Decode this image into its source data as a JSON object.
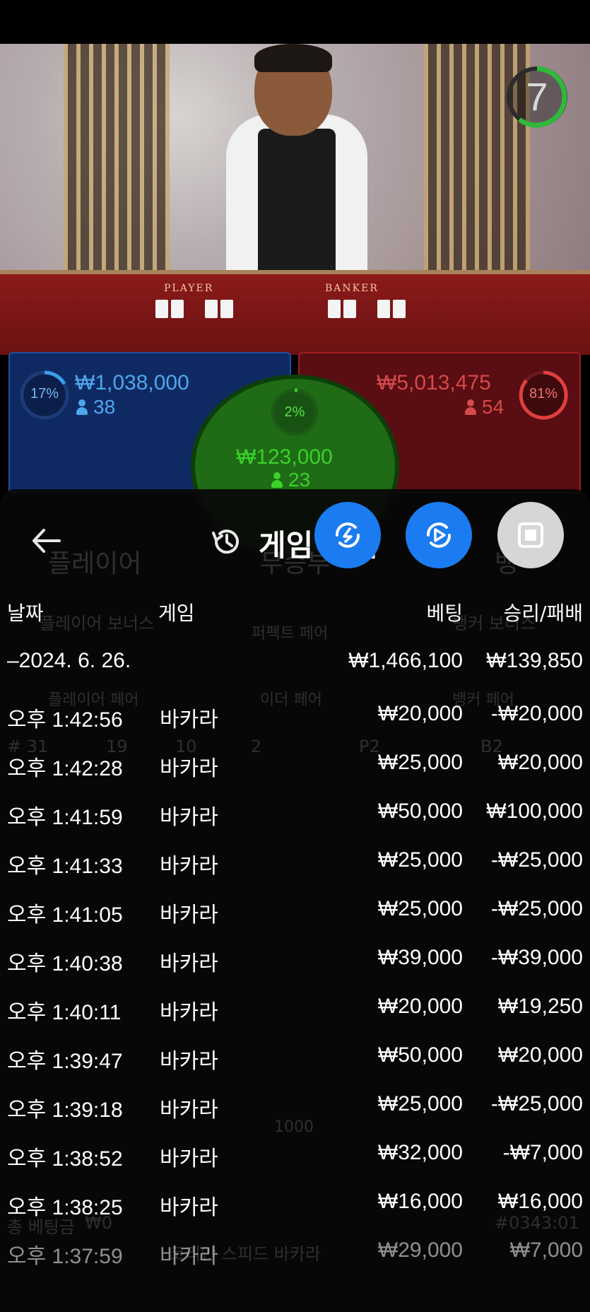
{
  "timer": {
    "value": "7"
  },
  "table_labels": {
    "player": "PLAYER",
    "banker": "BANKER"
  },
  "bets": {
    "player": {
      "percent": "17%",
      "amount": "₩1,038,000",
      "players": "38",
      "color": "#3aa0e8"
    },
    "banker": {
      "percent": "81%",
      "amount": "₩5,013,475",
      "players": "54",
      "color": "#e04040"
    },
    "tie": {
      "percent": "2%",
      "amount": "₩123,000",
      "players": "23",
      "color": "#3ad22a"
    }
  },
  "panel": {
    "title": "게임 내역",
    "back_icon": "arrow-left-icon",
    "history_icon": "history-icon",
    "buttons": [
      "lightning-link-icon",
      "play-cycle-icon",
      "stop-square-icon"
    ]
  },
  "background_ghost": {
    "player": "플레이어",
    "tie": "무승부",
    "banker": "뱅",
    "player_bonus": "플레이어 보너스",
    "perfect_pair": "퍼펙트 페어",
    "banker_bonus": "뱅커 보너스",
    "player_pair": "플레이어 페어",
    "either_pair": "이더 페어",
    "banker_pair": "뱅커 페어",
    "round": "# 31",
    "p_count": "19",
    "b_count": "10",
    "t_count": "2",
    "p2": "P2",
    "b2": "B2",
    "chip": "1000",
    "total_bet": "총 베팅금",
    "total_value": "₩0",
    "game_name": "코리안 스피드 바카라",
    "round_id": "#0343:01"
  },
  "columns": {
    "date": "날짜",
    "game": "게임",
    "bet": "베팅",
    "winloss": "승리/패배"
  },
  "summary": {
    "date": "–2024. 6. 26.",
    "bet": "₩1,466,100",
    "winloss": "₩139,850"
  },
  "rows": [
    {
      "time": "오후 1:42:56",
      "game": "바카라",
      "bet": "₩20,000",
      "winloss": "-₩20,000"
    },
    {
      "time": "오후 1:42:28",
      "game": "바카라",
      "bet": "₩25,000",
      "winloss": "₩20,000"
    },
    {
      "time": "오후 1:41:59",
      "game": "바카라",
      "bet": "₩50,000",
      "winloss": "₩100,000"
    },
    {
      "time": "오후 1:41:33",
      "game": "바카라",
      "bet": "₩25,000",
      "winloss": "-₩25,000"
    },
    {
      "time": "오후 1:41:05",
      "game": "바카라",
      "bet": "₩25,000",
      "winloss": "-₩25,000"
    },
    {
      "time": "오후 1:40:38",
      "game": "바카라",
      "bet": "₩39,000",
      "winloss": "-₩39,000"
    },
    {
      "time": "오후 1:40:11",
      "game": "바카라",
      "bet": "₩20,000",
      "winloss": "₩19,250"
    },
    {
      "time": "오후 1:39:47",
      "game": "바카라",
      "bet": "₩50,000",
      "winloss": "₩20,000"
    },
    {
      "time": "오후 1:39:18",
      "game": "바카라",
      "bet": "₩25,000",
      "winloss": "-₩25,000"
    },
    {
      "time": "오후 1:38:52",
      "game": "바카라",
      "bet": "₩32,000",
      "winloss": "-₩7,000"
    },
    {
      "time": "오후 1:38:25",
      "game": "바카라",
      "bet": "₩16,000",
      "winloss": "₩16,000"
    },
    {
      "time": "오후 1:37:59",
      "game": "바카라",
      "bet": "₩29,000",
      "winloss": "₩7,000"
    }
  ]
}
